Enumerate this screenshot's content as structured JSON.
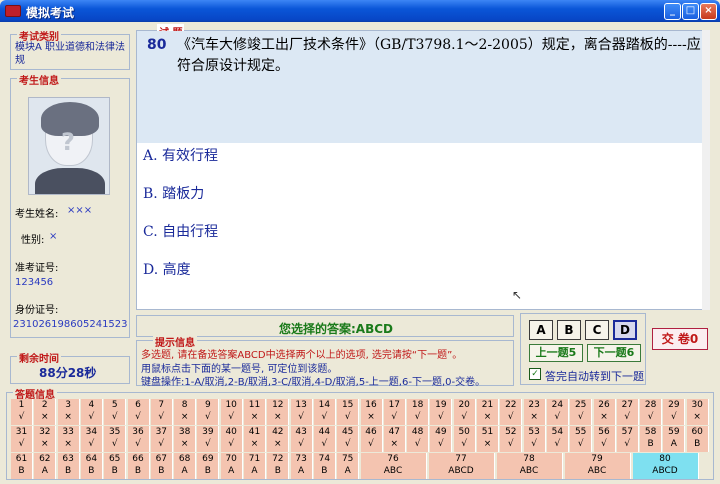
{
  "window": {
    "title": "模拟考试"
  },
  "exam_type": {
    "title": "考试类别",
    "value": "模块A 职业道德和法律法规"
  },
  "student": {
    "title": "考生信息",
    "name_label": "考生姓名:",
    "name_value": "×××",
    "gender_label": "性别:",
    "gender_value": "×",
    "admission_label": "准考证号:",
    "admission_value": "123456",
    "id_label": "身份证号:",
    "id_value": "231026198605241523"
  },
  "time": {
    "title": "剩余时间",
    "value": "88分28秒"
  },
  "question": {
    "title": "试 题",
    "number": "80",
    "text": "《汽车大修竣工出厂技术条件》（GB/T3798.1～2-2005）规定，离合器踏板的----应符合原设计规定。",
    "options": [
      "A. 有效行程",
      "B. 踏板力",
      "C. 自由行程",
      "D. 高度"
    ]
  },
  "answer": {
    "text": "您选择的答案:ABCD"
  },
  "hints": {
    "title": "提示信息",
    "line1": "多选题, 请在备选答案ABCD中选择两个以上的选项, 选完请按“下一题”。",
    "line2": "用鼠标点击下面的某一题号, 可定位到该题。",
    "line3": "键盘操作:1-A/取消,2-B/取消,3-C/取消,4-D/取消,5-上一题,6-下一题,0-交卷。"
  },
  "buttons": {
    "a": "A",
    "b": "B",
    "c": "C",
    "d": "D",
    "prev": "上一题5",
    "next": "下一题6",
    "auto_label": "答完自动转到下一题",
    "auto_checked": "✓",
    "submit": "交 卷0"
  },
  "grid": {
    "title": "答题信息",
    "row1": [
      {
        "n": "1",
        "a": "√"
      },
      {
        "n": "2",
        "a": "×"
      },
      {
        "n": "3",
        "a": "×"
      },
      {
        "n": "4",
        "a": "√"
      },
      {
        "n": "5",
        "a": "√"
      },
      {
        "n": "6",
        "a": "√"
      },
      {
        "n": "7",
        "a": "√"
      },
      {
        "n": "8",
        "a": "×"
      },
      {
        "n": "9",
        "a": "√"
      },
      {
        "n": "10",
        "a": "√"
      },
      {
        "n": "11",
        "a": "×"
      },
      {
        "n": "12",
        "a": "×"
      },
      {
        "n": "13",
        "a": "√"
      },
      {
        "n": "14",
        "a": "√"
      },
      {
        "n": "15",
        "a": "√"
      },
      {
        "n": "16",
        "a": "×"
      },
      {
        "n": "17",
        "a": "√"
      },
      {
        "n": "18",
        "a": "√"
      },
      {
        "n": "19",
        "a": "√"
      },
      {
        "n": "20",
        "a": "√"
      },
      {
        "n": "21",
        "a": "×"
      },
      {
        "n": "22",
        "a": "√"
      },
      {
        "n": "23",
        "a": "×"
      },
      {
        "n": "24",
        "a": "√"
      },
      {
        "n": "25",
        "a": "√"
      },
      {
        "n": "26",
        "a": "×"
      },
      {
        "n": "27",
        "a": "√"
      },
      {
        "n": "28",
        "a": "√"
      },
      {
        "n": "29",
        "a": "√"
      },
      {
        "n": "30",
        "a": "×"
      }
    ],
    "row2": [
      {
        "n": "31",
        "a": "√"
      },
      {
        "n": "32",
        "a": "×"
      },
      {
        "n": "33",
        "a": "×"
      },
      {
        "n": "34",
        "a": "√"
      },
      {
        "n": "35",
        "a": "√"
      },
      {
        "n": "36",
        "a": "√"
      },
      {
        "n": "37",
        "a": "√"
      },
      {
        "n": "38",
        "a": "×"
      },
      {
        "n": "39",
        "a": "√"
      },
      {
        "n": "40",
        "a": "√"
      },
      {
        "n": "41",
        "a": "×"
      },
      {
        "n": "42",
        "a": "×"
      },
      {
        "n": "43",
        "a": "√"
      },
      {
        "n": "44",
        "a": "√"
      },
      {
        "n": "45",
        "a": "√"
      },
      {
        "n": "46",
        "a": "√"
      },
      {
        "n": "47",
        "a": "×"
      },
      {
        "n": "48",
        "a": "√"
      },
      {
        "n": "49",
        "a": "√"
      },
      {
        "n": "50",
        "a": "√"
      },
      {
        "n": "51",
        "a": "×"
      },
      {
        "n": "52",
        "a": "√"
      },
      {
        "n": "53",
        "a": "√"
      },
      {
        "n": "54",
        "a": "√"
      },
      {
        "n": "55",
        "a": "√"
      },
      {
        "n": "56",
        "a": "√"
      },
      {
        "n": "57",
        "a": "√"
      },
      {
        "n": "58",
        "a": "B"
      },
      {
        "n": "59",
        "a": "A"
      },
      {
        "n": "60",
        "a": "B"
      }
    ],
    "row3": [
      {
        "n": "61",
        "a": "B"
      },
      {
        "n": "62",
        "a": "A"
      },
      {
        "n": "63",
        "a": "B"
      },
      {
        "n": "64",
        "a": "B"
      },
      {
        "n": "65",
        "a": "B"
      },
      {
        "n": "66",
        "a": "B"
      },
      {
        "n": "67",
        "a": "B"
      },
      {
        "n": "68",
        "a": "A"
      },
      {
        "n": "69",
        "a": "B"
      },
      {
        "n": "70",
        "a": "A"
      },
      {
        "n": "71",
        "a": "A"
      },
      {
        "n": "72",
        "a": "B"
      },
      {
        "n": "73",
        "a": "A"
      },
      {
        "n": "74",
        "a": "B"
      },
      {
        "n": "75",
        "a": "A"
      },
      {
        "n": "76",
        "a": "ABC",
        "wide": true
      },
      {
        "n": "77",
        "a": "ABCD",
        "wide": true
      },
      {
        "n": "78",
        "a": "ABC",
        "wide": true
      },
      {
        "n": "79",
        "a": "ABC",
        "wide": true
      },
      {
        "n": "80",
        "a": "ABCD",
        "wide": true,
        "current": true
      }
    ]
  }
}
